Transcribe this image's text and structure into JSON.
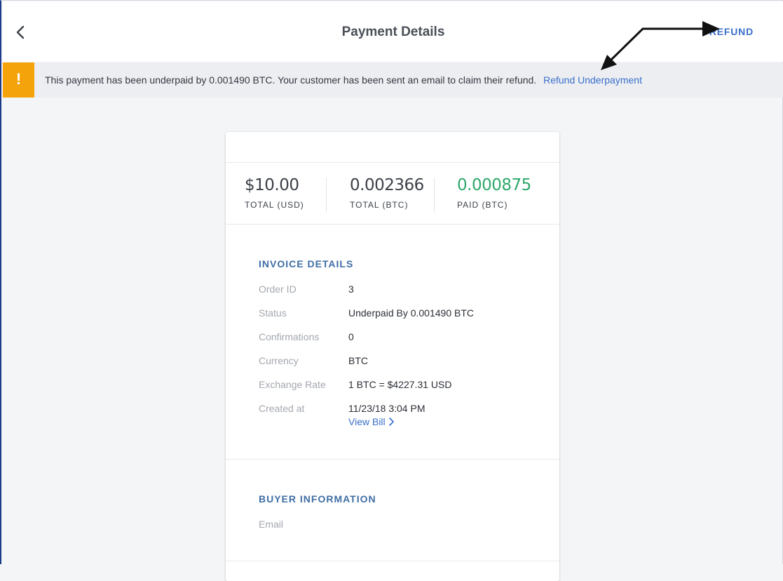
{
  "header": {
    "title": "Payment Details",
    "refund_label": "REFUND"
  },
  "alert": {
    "icon": "!",
    "message": "This payment has been underpaid by 0.001490 BTC. Your customer has been sent an email to claim their refund.",
    "link_label": "Refund Underpayment",
    "accent_color": "#f5a30a"
  },
  "summary": [
    {
      "value": "$10.00",
      "label": "TOTAL (USD)"
    },
    {
      "value": "0.002366",
      "label": "TOTAL (BTC)"
    },
    {
      "value": "0.000875",
      "label": "PAID (BTC)",
      "color": "#2fa86b"
    }
  ],
  "invoice": {
    "title": "INVOICE DETAILS",
    "rows": [
      {
        "label": "Order ID",
        "value": "3"
      },
      {
        "label": "Status",
        "value": "Underpaid By 0.001490 BTC"
      },
      {
        "label": "Confirmations",
        "value": "0"
      },
      {
        "label": "Currency",
        "value": "BTC"
      },
      {
        "label": "Exchange Rate",
        "value": "1 BTC = $4227.31 USD"
      },
      {
        "label": "Created at",
        "value": "11/23/18 3:04 PM"
      }
    ],
    "view_bill_label": "View Bill"
  },
  "buyer": {
    "title": "BUYER INFORMATION",
    "email_label": "Email",
    "email_value": ""
  },
  "icons": {
    "back": "chevron-left-icon",
    "alert": "exclamation-icon",
    "view_bill": "chevron-right-icon"
  }
}
